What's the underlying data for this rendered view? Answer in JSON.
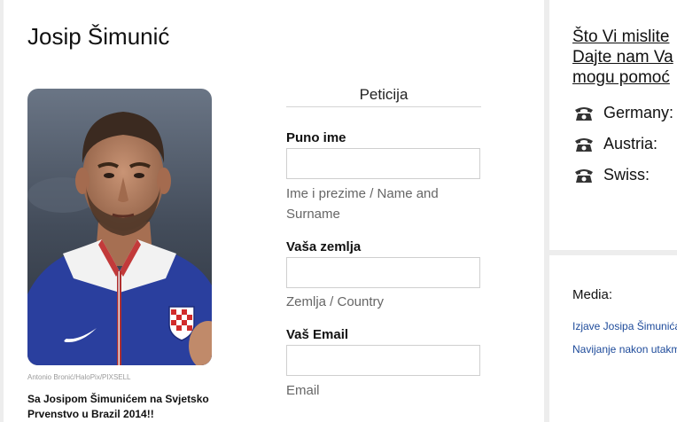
{
  "player": {
    "name": "Josip Šimunić",
    "photo_credit": "Antonio Bronić/HaloPix/PIXSELL",
    "caption": "Sa Josipom Šimunićem na Svjetsko Prvenstvo u Brazil 2014!!"
  },
  "petition": {
    "heading": "Peticija",
    "fields": [
      {
        "label": "Puno ime",
        "hint": "Ime i prezime / Name and Surname",
        "value": ""
      },
      {
        "label": "Vaša zemlja",
        "hint": "Zemlja / Country",
        "value": ""
      },
      {
        "label": "Vaš Email",
        "hint": "Email",
        "value": ""
      }
    ]
  },
  "sidebar": {
    "heading_lines": [
      "Što Vi mislite",
      "Dajte nam Va",
      "mogu pomoć"
    ],
    "phones": [
      {
        "icon": "telephone-icon",
        "label": "Germany:"
      },
      {
        "icon": "telephone-icon",
        "label": "Austria:"
      },
      {
        "icon": "telephone-icon",
        "label": "Swiss:"
      }
    ],
    "media": {
      "heading": "Media:",
      "links": [
        "Izjave Josipa Šimunića",
        "Navijanje nakon utakm"
      ]
    }
  },
  "colors": {
    "link_blue": "#1d4a9a",
    "jersey_blue": "#2a3f9e",
    "page_background": "#ededed"
  }
}
